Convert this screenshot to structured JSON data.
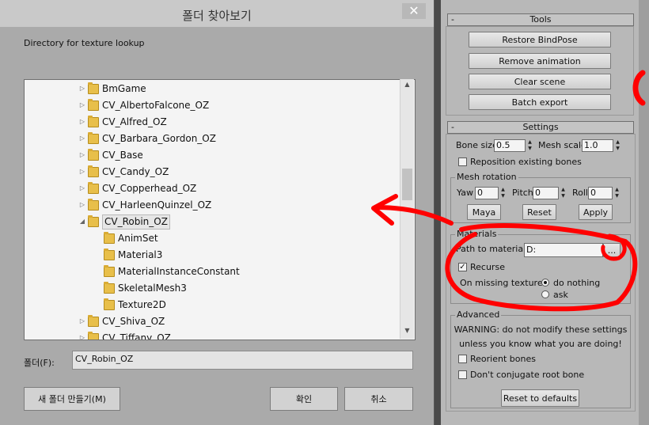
{
  "dialog": {
    "title": "폴더 찾아보기",
    "close_glyph": "✕",
    "description": "Directory for texture lookup",
    "tree": [
      {
        "label": "BmGame",
        "level": 0,
        "expander": "▷"
      },
      {
        "label": "CV_AlbertoFalcone_OZ",
        "level": 0,
        "expander": "▷"
      },
      {
        "label": "CV_Alfred_OZ",
        "level": 0,
        "expander": "▷"
      },
      {
        "label": "CV_Barbara_Gordon_OZ",
        "level": 0,
        "expander": "▷"
      },
      {
        "label": "CV_Base",
        "level": 0,
        "expander": "▷"
      },
      {
        "label": "CV_Candy_OZ",
        "level": 0,
        "expander": "▷"
      },
      {
        "label": "CV_Copperhead_OZ",
        "level": 0,
        "expander": "▷"
      },
      {
        "label": "CV_HarleenQuinzel_OZ",
        "level": 0,
        "expander": "▷"
      },
      {
        "label": "CV_Robin_OZ",
        "level": 0,
        "expander": "◢",
        "selected": true
      },
      {
        "label": "AnimSet",
        "level": 1,
        "expander": ""
      },
      {
        "label": "Material3",
        "level": 1,
        "expander": ""
      },
      {
        "label": "MaterialInstanceConstant",
        "level": 1,
        "expander": ""
      },
      {
        "label": "SkeletalMesh3",
        "level": 1,
        "expander": ""
      },
      {
        "label": "Texture2D",
        "level": 1,
        "expander": ""
      },
      {
        "label": "CV_Shiva_OZ",
        "level": 0,
        "expander": "▷"
      },
      {
        "label": "CV_Tiffany_OZ",
        "level": 0,
        "expander": "▷"
      }
    ],
    "scroll_up": "▲",
    "scroll_down": "▼",
    "folder_label": "폴더(F):",
    "folder_value": "CV_Robin_OZ",
    "new_folder_button": "새 폴더 만들기(M)",
    "ok_button": "확인",
    "cancel_button": "취소"
  },
  "tools": {
    "header": "Tools",
    "collapse": "-",
    "restore_bindpose": "Restore BindPose",
    "remove_animation": "Remove animation",
    "clear_scene": "Clear scene",
    "batch_export": "Batch export"
  },
  "settings": {
    "header": "Settings",
    "collapse": "-",
    "bone_size_label": "Bone size",
    "bone_size_value": "0.5",
    "mesh_scale_label": "Mesh scale",
    "mesh_scale_value": "1.0",
    "reposition_label": "Reposition existing bones",
    "mesh_rotation": {
      "title": "Mesh rotation",
      "yaw_label": "Yaw",
      "yaw_value": "0",
      "pitch_label": "Pitch",
      "pitch_value": "0",
      "roll_label": "Roll",
      "roll_value": "0",
      "maya_button": "Maya",
      "reset_button": "Reset",
      "apply_button": "Apply"
    },
    "materials": {
      "title": "Materials",
      "path_label": "Path to materials",
      "path_value": "D:₩Steam₩Tools",
      "browse_button": "...",
      "recurse_label": "Recurse",
      "missing_label": "On missing texture:",
      "do_nothing_label": "do nothing",
      "ask_label": "ask"
    },
    "advanced": {
      "title": "Advanced",
      "warning_line1": "WARNING: do not modify these settings",
      "warning_line2": "unless you know what you are doing!",
      "reorient_label": "Reorient bones",
      "no_conjugate_label": "Don't conjugate root bone",
      "reset_defaults_button": "Reset to defaults"
    }
  },
  "colors": {
    "annotation": "#ff0000",
    "dialog_bg": "#aaaaaa",
    "panel_bg": "#b8b8b8"
  }
}
